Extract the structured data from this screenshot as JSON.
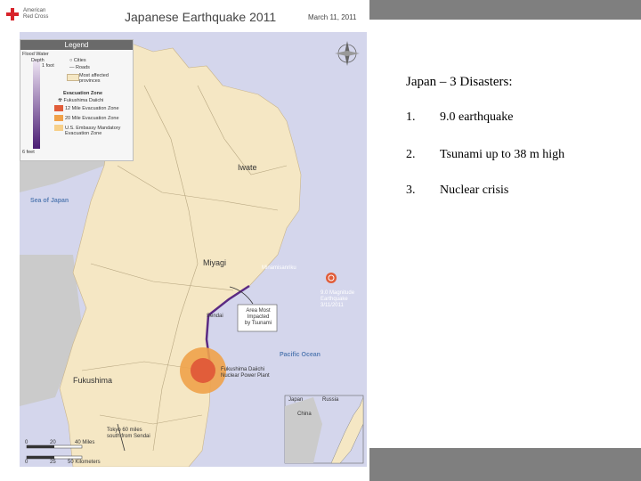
{
  "map": {
    "org_name_line1": "American",
    "org_name_line2": "Red Cross",
    "title": "Japanese Earthquake 2011",
    "date": "March 11, 2011",
    "legend": {
      "title": "Legend",
      "flood_water": "Flood Water",
      "depth": "Depth",
      "depth_top": "1 foot",
      "depth_bottom": "6 feet",
      "cities": "Cities",
      "roads": "Roads",
      "affected_1": "Most affected",
      "affected_2": "provinces",
      "evac_zone": "Evacuation Zone",
      "fukushima_daiichi": "Fukushima Daiichi",
      "evac_12": "12 Mile Evacuation Zone",
      "evac_20": "20 Mile Evacuation Zone",
      "embassy_1": "U.S. Embassy Mandatory",
      "embassy_2": "Evacuation Zone"
    },
    "labels": {
      "iwate": "Iwate",
      "miyagi": "Miyagi",
      "fukushima": "Fukushima",
      "sea_of_japan": "Sea of Japan",
      "pacific_ocean": "Pacific Ocean",
      "minamisanriku": "Minamisanriku",
      "sendai": "Sendai",
      "quake_1": "9.0 Magnitude",
      "quake_2": "Earthquake",
      "quake_3": "3/11/2011",
      "area_1": "Area Most",
      "area_2": "Impacted",
      "area_3": "by Tsunami",
      "plant_1": "Fukushima Daiichi",
      "plant_2": "Nuclear Power Plant",
      "tokyo_1": "Tokyo 60 miles",
      "tokyo_2": "south from Sendai",
      "inset_title": "Japan",
      "inset_china": "China",
      "inset_russia": "Russia"
    },
    "scale": {
      "miles_0": "0",
      "miles_20": "20",
      "miles_40": "40 Miles",
      "km_0": "0",
      "km_25": "25",
      "km_50": "50 Kilometers"
    },
    "colors": {
      "water": "#d4d6ec",
      "land": "#f5e7c4",
      "other_land": "#cbcbcb",
      "zone_12": "#e15d3a",
      "zone_20": "#f0a24a",
      "flood": "#5b2a83"
    }
  },
  "content": {
    "title": "Japan – 3 Disasters:",
    "items": [
      {
        "num": "1.",
        "text": "9.0 earthquake"
      },
      {
        "num": "2.",
        "text": "Tsunami up to 38 m high"
      },
      {
        "num": "3.",
        "text": "Nuclear crisis"
      }
    ]
  }
}
